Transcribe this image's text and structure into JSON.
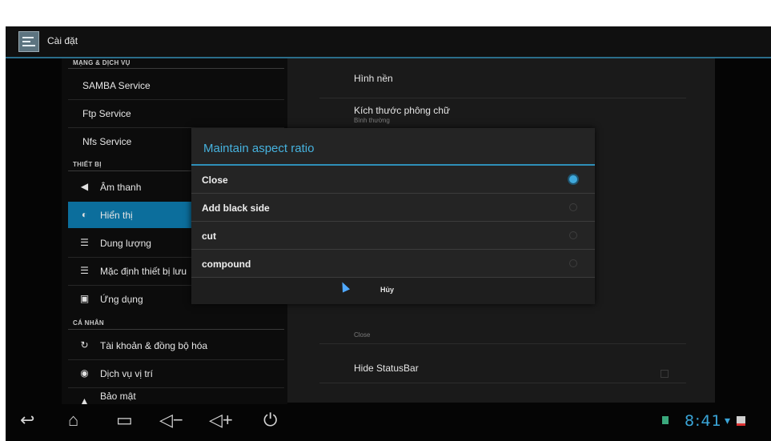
{
  "app": {
    "title": "Cài đặt"
  },
  "left": {
    "sections": {
      "network": "MẠNG & DỊCH VỤ",
      "device": "THIẾT BỊ",
      "personal": "CÁ NHÂN"
    },
    "items": {
      "samba": "SAMBA Service",
      "ftp": "Ftp Service",
      "nfs": "Nfs Service",
      "sound": "Âm thanh",
      "display": "Hiển thị",
      "storage": "Dung lượng",
      "default_storage": "Mặc định thiết bị lưu",
      "apps": "Ứng dụng",
      "accounts": "Tài khoản & đồng bộ hóa",
      "location": "Dịch vụ vị trí",
      "security": "Bảo mật"
    }
  },
  "right": {
    "wallpaper": "Hình nền",
    "font_size": "Kích thước phông chữ",
    "font_size_value": "Bình thường",
    "aspect_value": "Close",
    "hide_statusbar": "Hide StatusBar"
  },
  "dialog": {
    "title": "Maintain aspect ratio",
    "options": [
      "Close",
      "Add black side",
      "cut",
      "compound"
    ],
    "selected_index": 0,
    "cancel_label": "Hủy"
  },
  "status": {
    "clock": "8:41"
  },
  "colors": {
    "accent": "#46b2de",
    "selected_item": "#0c6e9c"
  }
}
